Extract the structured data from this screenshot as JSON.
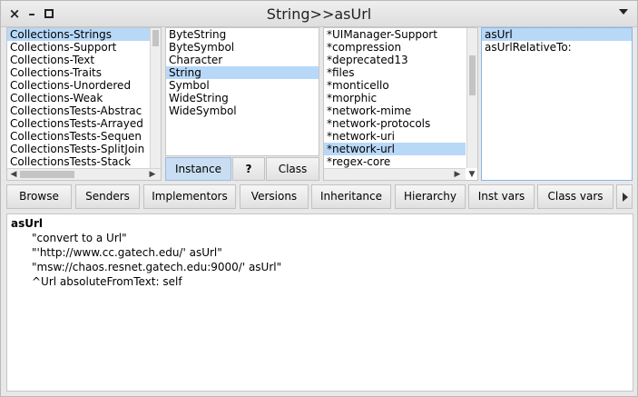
{
  "window": {
    "title": "String>>asUrl",
    "close_glyph": "×",
    "minimize_glyph": "–"
  },
  "categories": {
    "items": [
      "Collections-Strings",
      "Collections-Support",
      "Collections-Text",
      "Collections-Traits",
      "Collections-Unordered",
      "Collections-Weak",
      "CollectionsTests-Abstrac",
      "CollectionsTests-Arrayed",
      "CollectionsTests-Sequen",
      "CollectionsTests-SplitJoin",
      "CollectionsTests-Stack"
    ],
    "selected_index": 0
  },
  "classes": {
    "items": [
      "ByteString",
      "ByteSymbol",
      "Character",
      "String",
      "Symbol",
      "WideString",
      "WideSymbol"
    ],
    "selected_index": 3
  },
  "modes": {
    "instance": "Instance",
    "comment": "?",
    "class": "Class",
    "selected": "instance"
  },
  "protocols": {
    "items": [
      "*UIManager-Support",
      "*compression",
      "*deprecated13",
      "*files",
      "*monticello",
      "*morphic",
      "*network-mime",
      "*network-protocols",
      "*network-uri",
      "*network-url",
      "*regex-core"
    ],
    "selected_index": 9
  },
  "methods": {
    "items": [
      "asUrl",
      "asUrlRelativeTo:"
    ],
    "selected_index": 0
  },
  "toolbar": {
    "browse": "Browse",
    "senders": "Senders",
    "implementors": "Implementors",
    "versions": "Versions",
    "inheritance": "Inheritance",
    "hierarchy": "Hierarchy",
    "inst_vars": "Inst vars",
    "class_vars": "Class vars"
  },
  "code": {
    "header": "asUrl",
    "lines": [
      "\"convert to a Url\"",
      "\"'http://www.cc.gatech.edu/' asUrl\"",
      "\"msw://chaos.resnet.gatech.edu:9000/' asUrl\"",
      "^Url absoluteFromText: self"
    ]
  },
  "colors": {
    "selection": "#b8d8f8",
    "active_pane_border": "#8ab4e8",
    "toggle_selected": "#c9def2"
  }
}
